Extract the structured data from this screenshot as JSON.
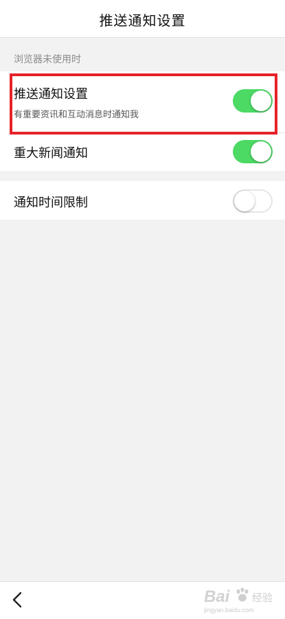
{
  "header": {
    "title": "推送通知设置"
  },
  "section": {
    "label": "浏览器未使用时"
  },
  "settings": [
    {
      "title": "推送通知设置",
      "subtitle": "有重要资讯和互动消息时通知我",
      "enabled": true
    },
    {
      "title": "重大新闻通知",
      "enabled": true
    },
    {
      "title": "通知时间限制",
      "enabled": false
    }
  ],
  "annotation": {
    "highlight_color": "#e52228"
  },
  "colors": {
    "toggle_on": "#4cd964",
    "toggle_off_border": "#e5e5e5",
    "page_background": "#f2f2f2"
  },
  "bottom_bar": {
    "back_icon": "chevron-left-icon"
  },
  "watermark": {
    "brand": "Bai",
    "suffix": "经验",
    "url": "jingyan.baidu.com"
  }
}
